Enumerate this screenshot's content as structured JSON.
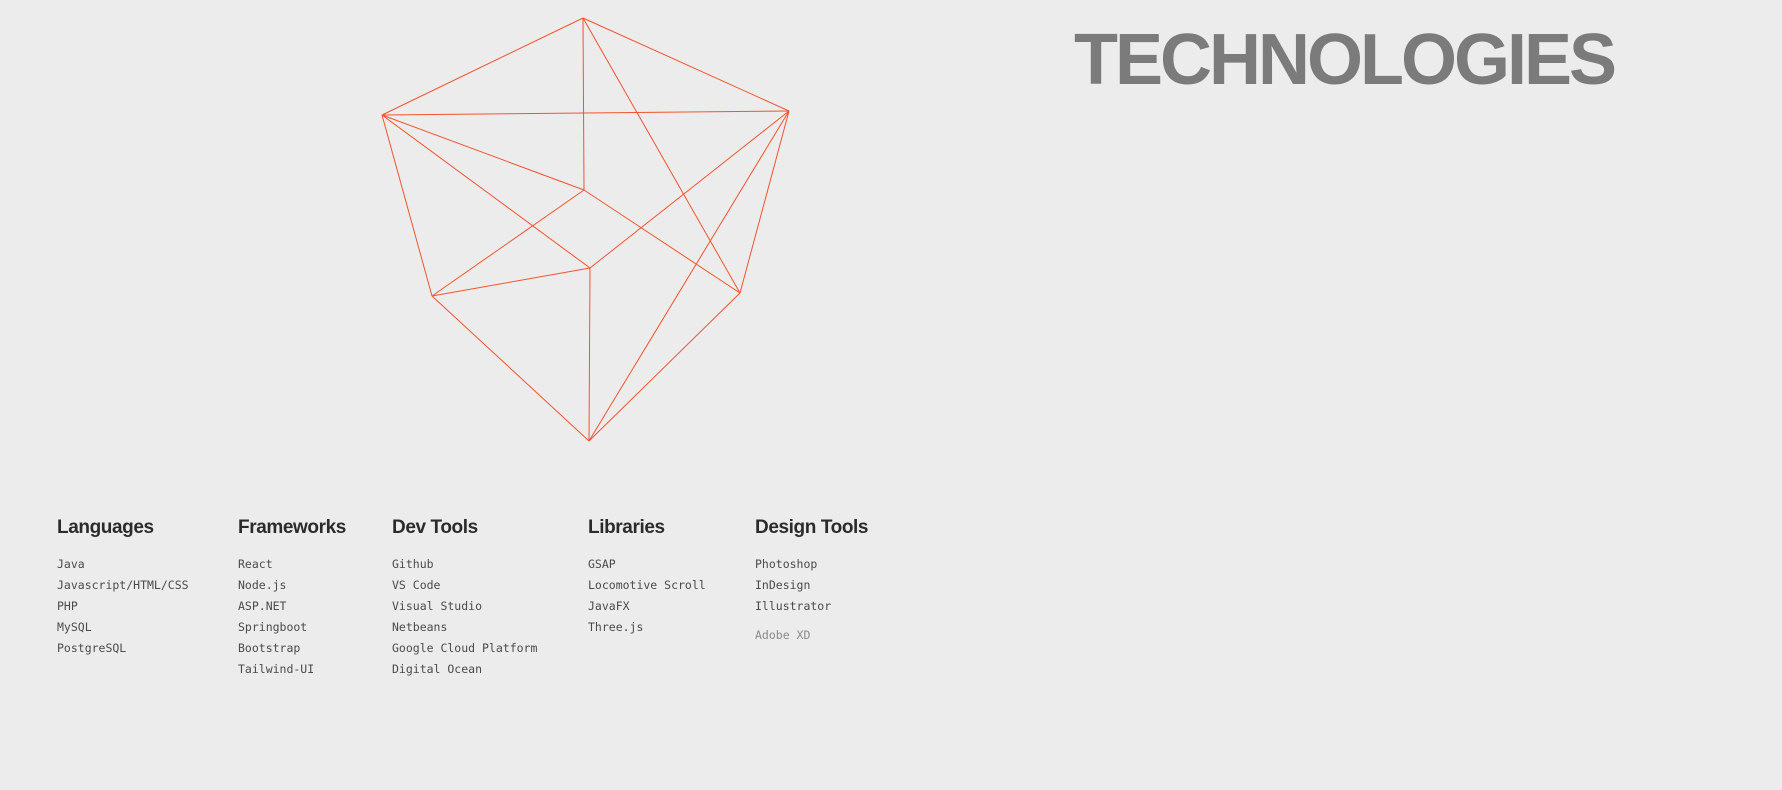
{
  "hero": {
    "title": "TECHNOLOGIES"
  },
  "decoration": {
    "icon": "wireframe-cube-icon",
    "stroke_color": "#f2542d"
  },
  "colors": {
    "background": "#ececec",
    "title": "#7b7b7b",
    "heading": "#2b2b2b",
    "item": "#4a4a4a",
    "muted_item": "#8a8a8a"
  },
  "categories": [
    {
      "title": "Languages",
      "items": [
        "Java",
        "Javascript/HTML/CSS",
        "PHP",
        "MySQL",
        "PostgreSQL"
      ]
    },
    {
      "title": "Frameworks",
      "items": [
        "React",
        "Node.js",
        "ASP.NET",
        "Springboot",
        "Bootstrap",
        "Tailwind-UI"
      ]
    },
    {
      "title": "Dev Tools",
      "items": [
        "Github",
        "VS Code",
        "Visual Studio",
        "Netbeans",
        "Google Cloud Platform",
        "Digital Ocean"
      ]
    },
    {
      "title": "Libraries",
      "items": [
        "GSAP",
        "Locomotive Scroll",
        "JavaFX",
        "Three.js"
      ]
    },
    {
      "title": "Design Tools",
      "items": [
        "Photoshop",
        "InDesign",
        "Illustrator",
        "Adobe XD"
      ]
    }
  ]
}
